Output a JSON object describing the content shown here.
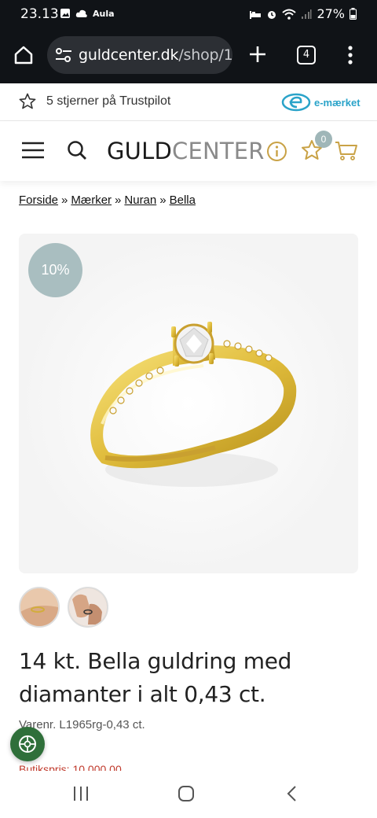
{
  "status_bar": {
    "time": "23.13",
    "notification_app": "Aula",
    "battery": "27%"
  },
  "browser": {
    "url_host": "guldcenter.dk",
    "url_path": "/shop/1",
    "tab_count": "4"
  },
  "trust_bar": {
    "trustpilot_text": "5 stjerner på Trustpilot",
    "emark_label": "e-mærket"
  },
  "header": {
    "logo_part1": "GULD",
    "logo_part2": "CENTER",
    "wishlist_count": "0",
    "accent_color": "#c9a246"
  },
  "breadcrumb": [
    "Forside",
    "Mærker",
    "Nuran",
    "Bella"
  ],
  "breadcrumb_separator": "»",
  "product": {
    "discount": "10%",
    "title": "14 kt. Bella guldring med diamanter i alt 0,43 ct.",
    "sku": "Varenr. L1965rg-0,43 ct.",
    "price_partial": "Butikspris: 10.000,00"
  },
  "icons": {
    "home": "home-icon",
    "site_settings": "tune-icon",
    "new_tab": "plus-icon",
    "more": "more-vertical-icon",
    "menu": "hamburger-icon",
    "search": "search-icon",
    "info": "info-icon",
    "wishlist": "star-icon",
    "cart": "cart-icon",
    "cookie": "cookie-icon"
  }
}
